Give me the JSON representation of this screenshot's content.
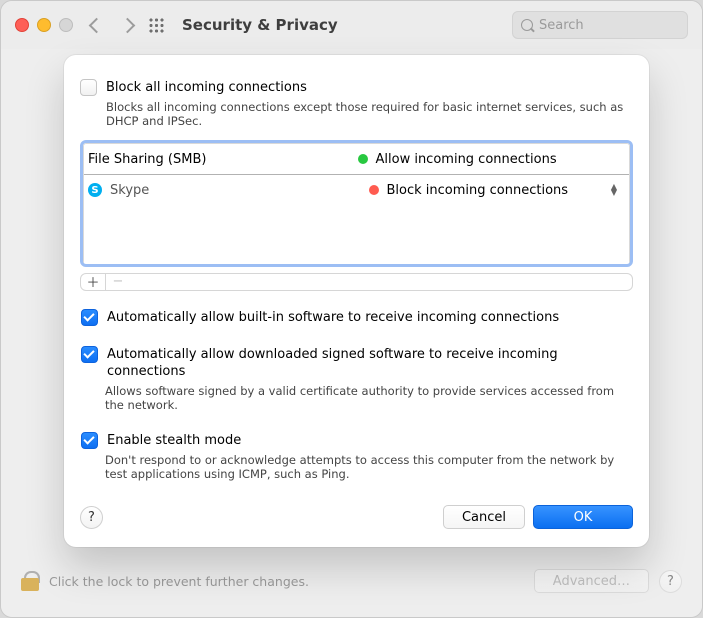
{
  "toolbar": {
    "title": "Security & Privacy",
    "search_placeholder": "Search"
  },
  "block_all": {
    "label": "Block all incoming connections",
    "desc": "Blocks all incoming connections except those required for basic internet services, such as DHCP and IPSec."
  },
  "list": {
    "rows": [
      {
        "name": "File Sharing (SMB)",
        "status": "Allow incoming connections",
        "dot": "green"
      },
      {
        "name": "Skype",
        "status": "Block incoming connections",
        "dot": "red"
      }
    ]
  },
  "options": {
    "auto_builtin": {
      "label": "Automatically allow built-in software to receive incoming connections"
    },
    "auto_signed": {
      "label": "Automatically allow downloaded signed software to receive incoming connections",
      "desc": "Allows software signed by a valid certificate authority to provide services accessed from the network."
    },
    "stealth": {
      "label": "Enable stealth mode",
      "desc": "Don't respond to or acknowledge attempts to access this computer from the network by test applications using ICMP, such as Ping."
    }
  },
  "buttons": {
    "cancel": "Cancel",
    "ok": "OK",
    "advanced": "Advanced…",
    "help": "?"
  },
  "lock_text": "Click the lock to prevent further changes."
}
